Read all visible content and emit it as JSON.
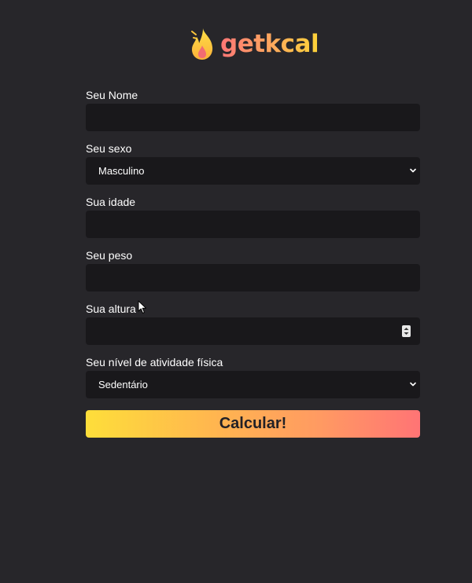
{
  "brand": {
    "name": "getkcal",
    "logo_icon": "flame-icon"
  },
  "form": {
    "name_label": "Seu Nome",
    "name_value": "",
    "sex_label": "Seu sexo",
    "sex_value": "Masculino",
    "age_label": "Sua idade",
    "age_value": "",
    "weight_label": "Seu peso",
    "weight_value": "",
    "height_label": "Sua altura",
    "height_value": "",
    "activity_label": "Seu nível de atividade física",
    "activity_value": "Sedentário",
    "submit_label": "Calcular!"
  },
  "colors": {
    "background": "#27262a",
    "input_background": "#19181b",
    "gradient_start": "#fede3a",
    "gradient_end": "#ff7475"
  }
}
